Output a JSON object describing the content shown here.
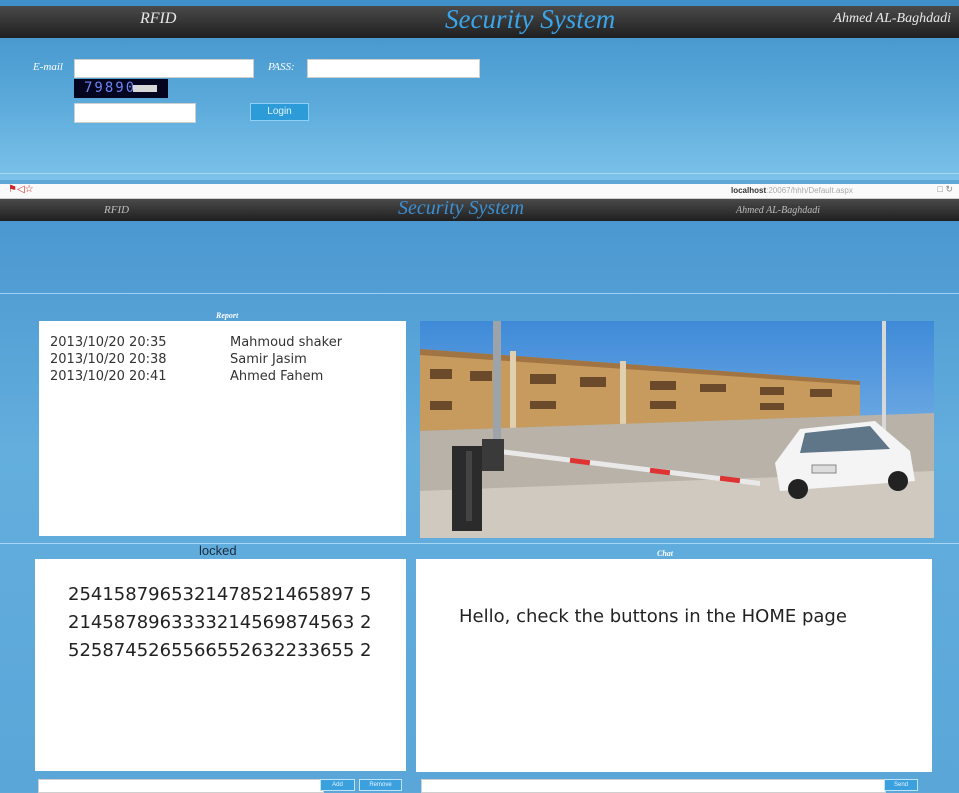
{
  "login_page": {
    "header": {
      "left": "RFID",
      "title": "Security System",
      "right": "Ahmed AL-Baghdadi"
    },
    "email_label": "E-mail",
    "email_value": "",
    "pass_label": "PASS:",
    "pass_value": "",
    "captcha_text": "79890",
    "captcha_value": "",
    "login_button": "Login"
  },
  "browser": {
    "url_host": "localhost",
    "url_rest": ":20067/hhh/Default.aspx"
  },
  "main_page": {
    "header": {
      "left": "RFID",
      "title": "Security System",
      "right": "Ahmed AL-Baghdadi"
    },
    "report": {
      "title": "Report",
      "rows": [
        {
          "datetime": "2013/10/20  20:35",
          "name": "Mahmoud shaker"
        },
        {
          "datetime": "2013/10/20  20:38",
          "name": "Samir Jasim"
        },
        {
          "datetime": "2013/10/20  20:41",
          "name": "Ahmed Fahem"
        }
      ]
    },
    "locked": {
      "label": "locked",
      "lines": [
        "2541587965321478521465897 5",
        "2145878963333214569874563 2",
        "5258745265566552632233655 2"
      ],
      "add_button": "Add",
      "remove_button": "Remove"
    },
    "chat": {
      "title": "Chat",
      "message": "Hello, check the buttons in the HOME page",
      "send_button": "Send"
    }
  },
  "colors": {
    "title_blue": "#3aa5ea",
    "background_blue": "#5fa7d6",
    "header_dark": "#2a2a2a"
  }
}
